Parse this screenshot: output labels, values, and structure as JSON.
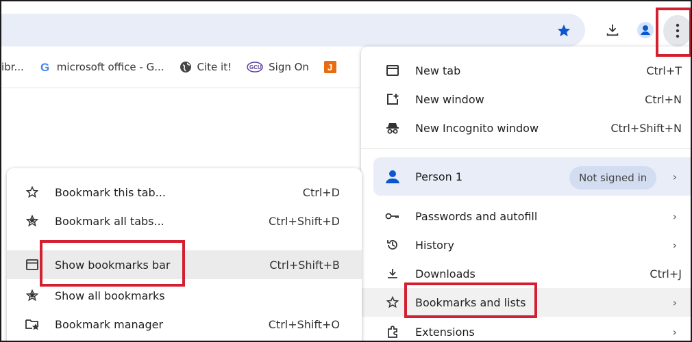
{
  "colors": {
    "accent": "#0b57d0",
    "highlight_box": "#d32030",
    "omnibox_bg": "#e8edf7"
  },
  "toolbar": {
    "star_icon": "star-icon",
    "download_icon": "download-icon",
    "profile_icon": "profile-icon",
    "menu_icon": "kebab-menu-icon"
  },
  "bookmarks_bar": {
    "items": [
      {
        "label": "ibr...",
        "icon": "none"
      },
      {
        "label": "microsoft office - G...",
        "icon": "google-icon"
      },
      {
        "label": "Cite it!",
        "icon": "globe-icon"
      },
      {
        "label": "Sign On",
        "icon": "gcu-icon",
        "icon_text": "GCU"
      },
      {
        "label": "",
        "icon": "j-icon",
        "icon_text": "J"
      }
    ]
  },
  "main_menu": {
    "items": [
      {
        "label": "New tab",
        "shortcut": "Ctrl+T"
      },
      {
        "label": "New window",
        "shortcut": "Ctrl+N"
      },
      {
        "label": "New Incognito window",
        "shortcut": "Ctrl+Shift+N"
      }
    ],
    "person": {
      "label": "Person 1",
      "badge": "Not signed in"
    },
    "items2": [
      {
        "label": "Passwords and autofill",
        "shortcut": ""
      },
      {
        "label": "History",
        "shortcut": ""
      },
      {
        "label": "Downloads",
        "shortcut": "Ctrl+J"
      },
      {
        "label": "Bookmarks and lists",
        "shortcut": ""
      },
      {
        "label": "Extensions",
        "shortcut": ""
      }
    ]
  },
  "bookmarks_submenu": {
    "items": [
      {
        "label": "Bookmark this tab...",
        "shortcut": "Ctrl+D"
      },
      {
        "label": "Bookmark all tabs...",
        "shortcut": "Ctrl+Shift+D"
      },
      {
        "label": "Show bookmarks bar",
        "shortcut": "Ctrl+Shift+B"
      },
      {
        "label": "Show all bookmarks",
        "shortcut": ""
      },
      {
        "label": "Bookmark manager",
        "shortcut": "Ctrl+Shift+O"
      }
    ]
  }
}
